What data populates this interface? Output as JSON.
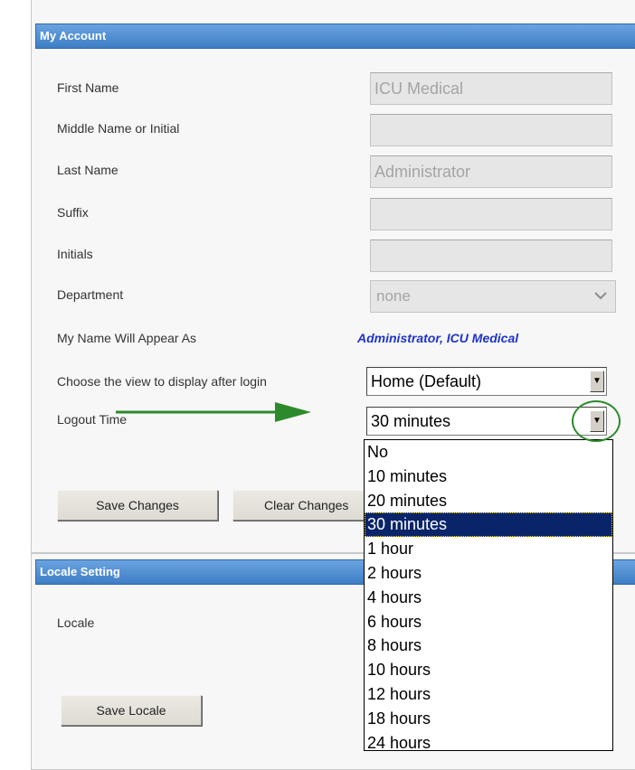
{
  "my_account": {
    "title": "My Account",
    "fields": [
      {
        "label": "First Name",
        "value": "ICU Medical"
      },
      {
        "label": "Middle Name or Initial",
        "value": ""
      },
      {
        "label": "Last Name",
        "value": "Administrator"
      },
      {
        "label": "Suffix",
        "value": ""
      },
      {
        "label": "Initials",
        "value": ""
      }
    ],
    "department": {
      "label": "Department",
      "value": "none",
      "icon": "chevron-down-icon"
    },
    "name_appearance": {
      "label": "My Name Will Appear As",
      "value": "Administrator, ICU Medical"
    },
    "view_after_login": {
      "label": "Choose the view to display after login",
      "value": "Home (Default)"
    },
    "logout_time": {
      "label": "Logout Time",
      "value": "30 minutes",
      "options": [
        "No",
        "10 minutes",
        "20 minutes",
        "30 minutes",
        "1 hour",
        "2 hours",
        "4 hours",
        "6 hours",
        "8 hours",
        "10 hours",
        "12 hours",
        "18 hours",
        "24 hours"
      ],
      "selected_index": 3
    },
    "buttons": {
      "save": "Save Changes",
      "clear": "Clear Changes"
    }
  },
  "locale_setting": {
    "title": "Locale Setting",
    "label": "Locale",
    "save_button": "Save Locale"
  },
  "annotation": {
    "arrow_color": "#2c8a2c",
    "circle_color": "#2c8a2c"
  }
}
